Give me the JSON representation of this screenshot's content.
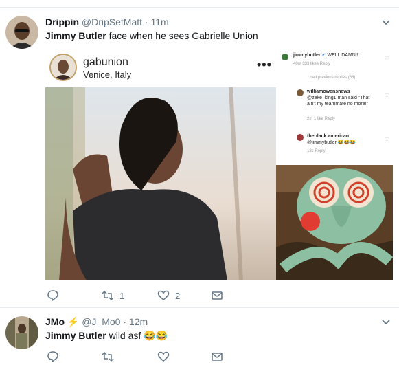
{
  "tweets": [
    {
      "name": "Drippin",
      "handle": "@DripSetMatt",
      "separator": "·",
      "time": "11m",
      "text_mention": "Jimmy Butler",
      "text_rest": " face when he sees  Gabrielle Union",
      "actions": {
        "reply": "",
        "retweet": "1",
        "like": "2"
      }
    },
    {
      "name": "JMo",
      "emoji": "⚡",
      "handle": "@J_Mo0",
      "separator": "·",
      "time": "12m",
      "text_mention": "Jimmy Butler",
      "text_rest": " wild asf ",
      "text_emoji": "😂😂",
      "actions": {
        "reply": "",
        "retweet": "",
        "like": ""
      }
    }
  ],
  "instagram": {
    "username": "gabunion",
    "location": "Venice, Italy",
    "more": "•••",
    "comments": [
      {
        "user": "jimmybutler",
        "verified": "✔",
        "text": "WELL DAMN!!",
        "meta": "40m   333 likes   Reply"
      },
      {
        "load": "Load previous replies (66)"
      },
      {
        "user": "williamowensnews",
        "text": "@zeke_king1 man said \"That ain't my teammate no more!\"",
        "meta": "2m   1 like   Reply"
      },
      {
        "user": "theblack.american",
        "text": "@jimmybutler 😂😂😂",
        "meta": "18s   Reply"
      }
    ]
  },
  "colors": {
    "accent": "#1da1f2",
    "muted": "#657786",
    "border": "#e6ecf0"
  }
}
